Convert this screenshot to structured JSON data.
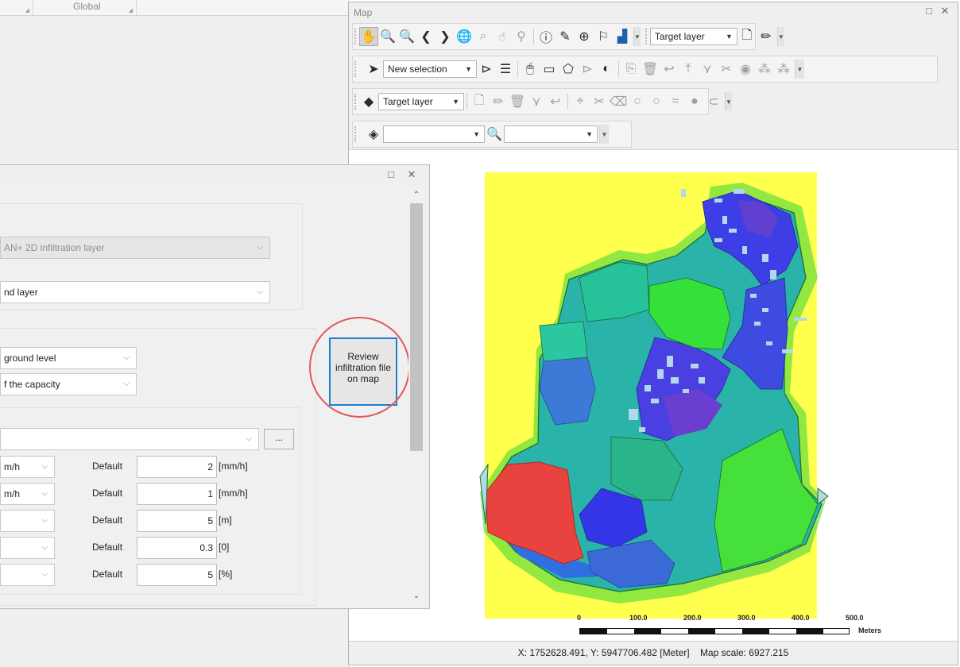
{
  "left_header": {
    "global": "Global"
  },
  "map_window": {
    "title": "Map",
    "toolbar1": {
      "target_layer": "Target layer"
    },
    "toolbar2": {
      "selection_mode": "New selection"
    },
    "toolbar3": {
      "target_layer": "Target layer"
    },
    "toolbar4": {
      "layer_value": "",
      "search_value": ""
    },
    "status": {
      "coordinates": "X: 1752628.491, Y: 5947706.482 [Meter]",
      "map_scale": "Map scale: 6927.215"
    },
    "scale_bar": {
      "ticks": [
        "0",
        "100.0",
        "200.0",
        "300.0",
        "400.0",
        "500.0"
      ],
      "units": "Meters"
    }
  },
  "dialog": {
    "layer_select": "AN+ 2D infiltration layer",
    "ground_layer_select": "nd layer",
    "ground_level_select": "ground level",
    "capacity_select": "f the capacity",
    "file_select": "",
    "browse_label": "...",
    "review_button": "Review infiltration file on map",
    "rows": [
      {
        "unit_select": "m/h",
        "label": "Default",
        "value": "2",
        "unit": "[mm/h]"
      },
      {
        "unit_select": "m/h",
        "label": "Default",
        "value": "1",
        "unit": "[mm/h]"
      },
      {
        "unit_select": "",
        "label": "Default",
        "value": "5",
        "unit": "[m]"
      },
      {
        "unit_select": "",
        "label": "Default",
        "value": "0.3",
        "unit": "[0]"
      },
      {
        "unit_select": "",
        "label": "Default",
        "value": "5",
        "unit": "[%]"
      }
    ]
  },
  "colors": {
    "map_background": "#ffff4d",
    "deep_blue": "#3a3ae6",
    "green": "#36d636",
    "red": "#e8433e",
    "highlight_circle": "#e35858",
    "accent_border": "#1c7fd0"
  }
}
